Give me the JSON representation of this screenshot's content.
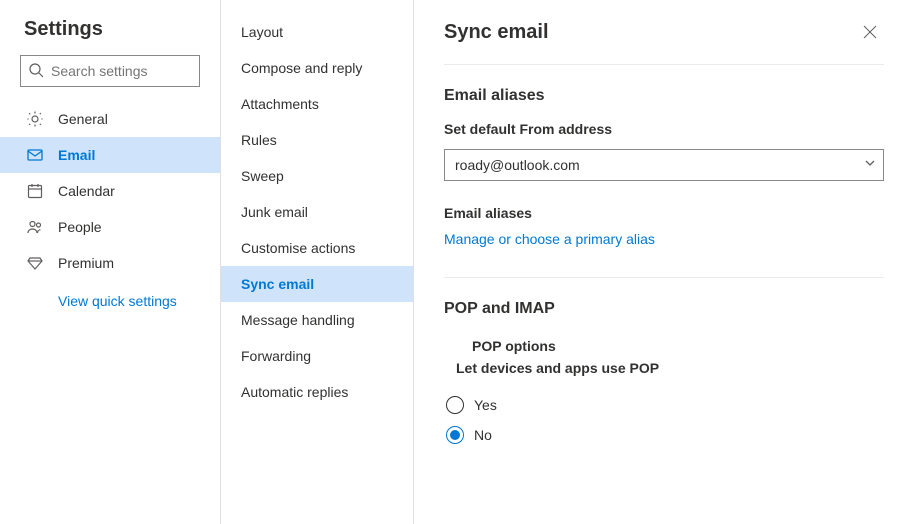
{
  "sidebar": {
    "title": "Settings",
    "search_placeholder": "Search settings",
    "items": [
      {
        "label": "General"
      },
      {
        "label": "Email"
      },
      {
        "label": "Calendar"
      },
      {
        "label": "People"
      },
      {
        "label": "Premium"
      }
    ],
    "quick_link": "View quick settings"
  },
  "sublist": {
    "items": [
      {
        "label": "Layout"
      },
      {
        "label": "Compose and reply"
      },
      {
        "label": "Attachments"
      },
      {
        "label": "Rules"
      },
      {
        "label": "Sweep"
      },
      {
        "label": "Junk email"
      },
      {
        "label": "Customise actions"
      },
      {
        "label": "Sync email"
      },
      {
        "label": "Message handling"
      },
      {
        "label": "Forwarding"
      },
      {
        "label": "Automatic replies"
      }
    ]
  },
  "panel": {
    "title": "Sync email",
    "aliases": {
      "section_title": "Email aliases",
      "default_from_label": "Set default From address",
      "default_from_value": "roady@outlook.com",
      "aliases_label": "Email aliases",
      "manage_link": "Manage or choose a primary alias"
    },
    "pop_imap": {
      "section_title": "POP and IMAP",
      "pop_options_label": "POP options",
      "allow_pop_label": "Let devices and apps use POP",
      "options": {
        "yes": "Yes",
        "no": "No"
      }
    }
  }
}
